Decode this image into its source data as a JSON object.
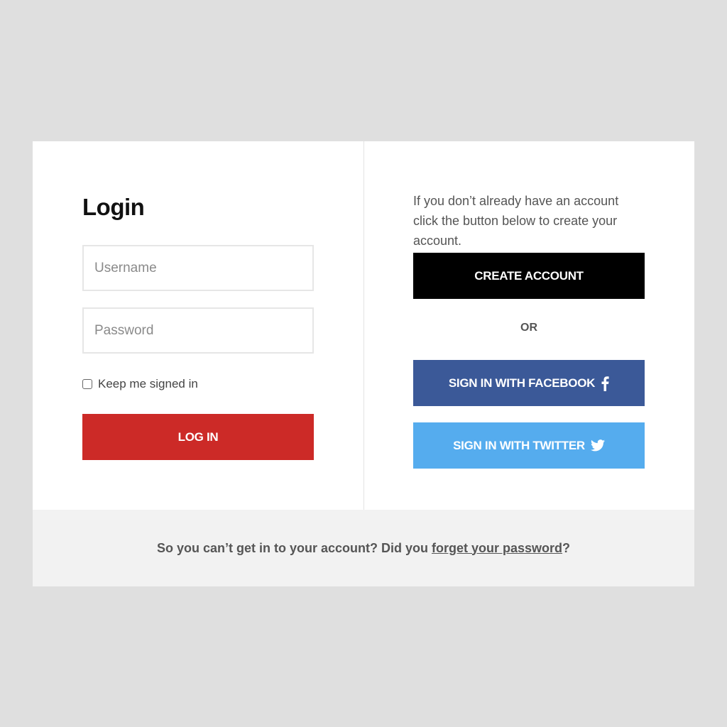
{
  "login": {
    "title": "Login",
    "username_placeholder": "Username",
    "password_placeholder": "Password",
    "remember_label": "Keep me signed in",
    "login_button": "LOG IN"
  },
  "signup": {
    "description": "If you don’t already have an account click the button below to create your account.",
    "create_button": "CREATE ACCOUNT",
    "or_text": "OR",
    "facebook_button": "SIGN IN WITH FACEBOOK",
    "twitter_button": "SIGN IN WITH TWITTER"
  },
  "footer": {
    "text_before": "So you can’t get in to your account? Did you ",
    "link_text": "forget your password",
    "text_after": "?"
  },
  "icons": {
    "facebook": "facebook-icon",
    "twitter": "twitter-icon"
  },
  "colors": {
    "background": "#dfdfdf",
    "login_button": "#cc2a27",
    "create_button": "#000000",
    "facebook": "#3b5998",
    "twitter": "#55acee",
    "footer_background": "#f2f2f2"
  }
}
